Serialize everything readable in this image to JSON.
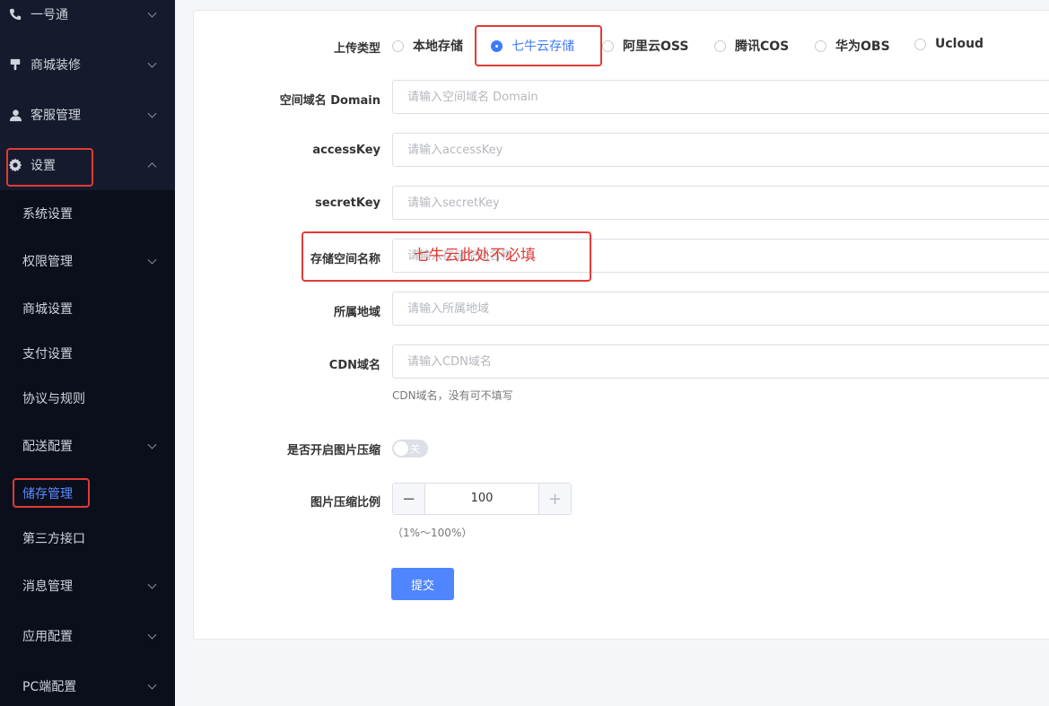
{
  "sidebar": {
    "top_items": [
      {
        "label": "一号通",
        "icon": "phone-icon"
      },
      {
        "label": "商城装修",
        "icon": "brush-icon"
      },
      {
        "label": "客服管理",
        "icon": "user-icon"
      },
      {
        "label": "设置",
        "icon": "gear-icon"
      }
    ],
    "sub_items": [
      {
        "label": "系统设置"
      },
      {
        "label": "权限管理"
      },
      {
        "label": "商城设置"
      },
      {
        "label": "支付设置"
      },
      {
        "label": "协议与规则"
      },
      {
        "label": "配送配置"
      },
      {
        "label": "储存管理"
      },
      {
        "label": "第三方接口"
      },
      {
        "label": "消息管理"
      },
      {
        "label": "应用配置"
      },
      {
        "label": "PC端配置"
      }
    ],
    "active": "储存管理"
  },
  "form": {
    "upload_type": {
      "label": "上传类型",
      "options": [
        "本地存储",
        "七牛云存储",
        "阿里云OSS",
        "腾讯COS",
        "华为OBS",
        "Ucloud"
      ],
      "selected": "七牛云存储"
    },
    "domain": {
      "label": "空间域名 Domain",
      "placeholder": "请输入空间域名 Domain",
      "value": ""
    },
    "access_key": {
      "label": "accessKey",
      "placeholder": "请输入accessKey",
      "value": ""
    },
    "secret_key": {
      "label": "secretKey",
      "placeholder": "请输入secretKey",
      "value": ""
    },
    "bucket": {
      "label": "存储空间名称",
      "placeholder": "请输入存储空间名称",
      "value": ""
    },
    "region": {
      "label": "所属地域",
      "placeholder": "请输入所属地域",
      "value": ""
    },
    "cdn": {
      "label": "CDN域名",
      "placeholder": "请输入CDN域名",
      "value": "",
      "hint": "CDN域名，没有可不填写"
    },
    "compress": {
      "label": "是否开启图片压缩",
      "switch_text": "关",
      "enabled": false
    },
    "ratio": {
      "label": "图片压缩比例",
      "value": "100",
      "minus": "−",
      "plus": "+",
      "hint": "（1%～100%）"
    },
    "submit_label": "提交"
  },
  "annotation": {
    "text": "七牛云此处不必填"
  },
  "colors": {
    "accent": "#3d7bff",
    "annotation": "#e03b36",
    "sidebar_bg": "#0b0f1c"
  }
}
